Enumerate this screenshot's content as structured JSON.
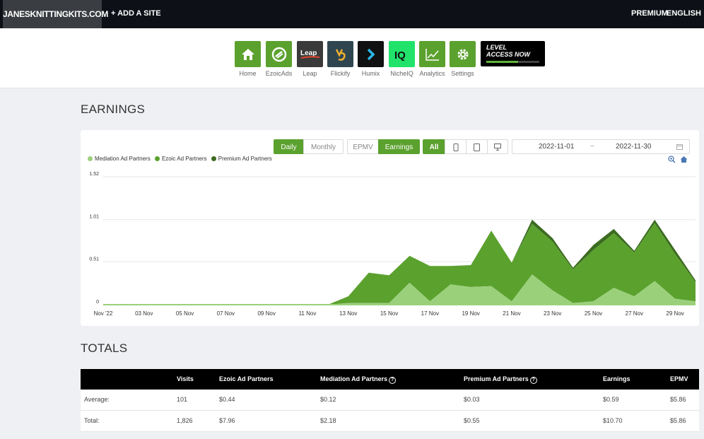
{
  "topbar": {
    "site_name": "JANESKNITTINGKITS.COM",
    "add_site": "+ ADD A SITE",
    "premium": "PREMIUM",
    "language": "ENGLISH"
  },
  "apps": [
    {
      "label": "Home",
      "icon": "home-icon",
      "color": "#5ba12e"
    },
    {
      "label": "EzoicAds",
      "icon": "ezoicads-icon",
      "color": "#5ba12e"
    },
    {
      "label": "Leap",
      "icon": "leap-icon",
      "color": "#3a3a3a"
    },
    {
      "label": "Flickify",
      "icon": "flickify-icon",
      "color": "#2f4650"
    },
    {
      "label": "Humix",
      "icon": "humix-icon",
      "color": "#111111"
    },
    {
      "label": "NicheIQ",
      "icon": "nicheiq-icon",
      "color": "#21e36b"
    },
    {
      "label": "Analytics",
      "icon": "analytics-icon",
      "color": "#5ba12e"
    },
    {
      "label": "Settings",
      "icon": "gear-icon",
      "color": "#5ba12e"
    }
  ],
  "level_banner": {
    "line1": "LEVEL",
    "line2": "ACCESS NOW"
  },
  "earnings_title": "EARNINGS",
  "totals_title": "TOTALS",
  "controls": {
    "daily": "Daily",
    "monthly": "Monthly",
    "epmv": "EPMV",
    "earnings": "Earnings",
    "all": "All",
    "date_start": "2022-11-01",
    "date_sep": "~",
    "date_end": "2022-11-30"
  },
  "colors": {
    "accent": "#5ba12e",
    "ezoic": "#5ba12e",
    "mediation": "#9bd07b",
    "premium": "#3b6b20"
  },
  "chart_data": {
    "type": "area",
    "stacked": true,
    "x": [
      "2022-11-01",
      "2022-11-02",
      "2022-11-03",
      "2022-11-04",
      "2022-11-05",
      "2022-11-06",
      "2022-11-07",
      "2022-11-08",
      "2022-11-09",
      "2022-11-10",
      "2022-11-11",
      "2022-11-12",
      "2022-11-13",
      "2022-11-14",
      "2022-11-15",
      "2022-11-16",
      "2022-11-17",
      "2022-11-18",
      "2022-11-19",
      "2022-11-20",
      "2022-11-21",
      "2022-11-22",
      "2022-11-23",
      "2022-11-24",
      "2022-11-25",
      "2022-11-26",
      "2022-11-27",
      "2022-11-28",
      "2022-11-29",
      "2022-11-30"
    ],
    "tick_labels": [
      "Nov '22",
      "03 Nov",
      "05 Nov",
      "07 Nov",
      "09 Nov",
      "11 Nov",
      "13 Nov",
      "15 Nov",
      "17 Nov",
      "19 Nov",
      "21 Nov",
      "23 Nov",
      "25 Nov",
      "27 Nov",
      "29 Nov"
    ],
    "y_ticks": [
      "1.52",
      "1.01",
      "0.51",
      "0"
    ],
    "ylim": [
      0,
      1.52
    ],
    "series": [
      {
        "name": "Mediation Ad Partners",
        "values": [
          0,
          0,
          0,
          0,
          0,
          0,
          0,
          0,
          0,
          0,
          0,
          0,
          0.02,
          0.02,
          0.02,
          0.26,
          0.04,
          0.24,
          0.21,
          0.22,
          0.04,
          0.36,
          0.17,
          0.02,
          0.04,
          0.2,
          0.1,
          0.28,
          0.07,
          0.04
        ]
      },
      {
        "name": "Ezoic Ad Partners",
        "values": [
          0,
          0,
          0,
          0,
          0,
          0,
          0,
          0,
          0,
          0,
          0,
          0,
          0.08,
          0.36,
          0.33,
          0.32,
          0.42,
          0.22,
          0.26,
          0.66,
          0.46,
          0.6,
          0.58,
          0.4,
          0.61,
          0.65,
          0.52,
          0.69,
          0.53,
          0.23
        ]
      },
      {
        "name": "Premium Ad Partners",
        "values": [
          0,
          0,
          0,
          0,
          0,
          0,
          0,
          0,
          0,
          0,
          0,
          0,
          0,
          0,
          0,
          0,
          0,
          0,
          0,
          0,
          0,
          0.05,
          0.04,
          0.02,
          0.06,
          0.05,
          0.02,
          0.04,
          0.05,
          0.02
        ]
      }
    ]
  },
  "totals": {
    "headers": [
      "",
      "Visits",
      "Ezoic Ad Partners",
      "Mediation Ad Partners",
      "Premium Ad Partners",
      "Earnings",
      "EPMV"
    ],
    "rows": [
      [
        "Average:",
        "101",
        "$0.44",
        "$0.12",
        "$0.03",
        "$0.59",
        "$5.86"
      ],
      [
        "Total:",
        "1,826",
        "$7.96",
        "$2.18",
        "$0.55",
        "$10.70",
        "$5.86"
      ]
    ]
  }
}
